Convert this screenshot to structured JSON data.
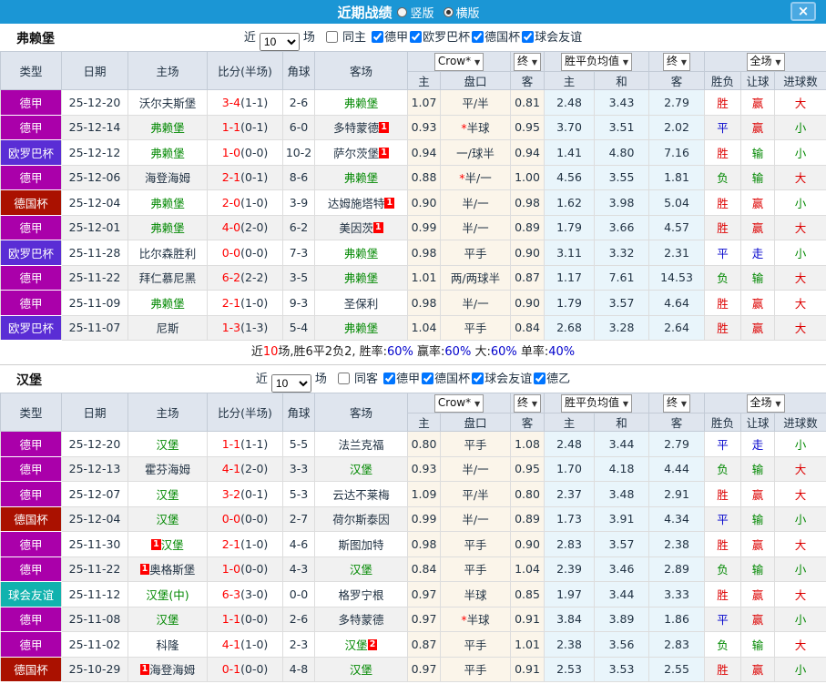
{
  "title_bar": {
    "title": "近期战绩",
    "layout_options": [
      {
        "label": "竖版",
        "selected": false
      },
      {
        "label": "横版",
        "selected": true
      }
    ],
    "close_label": "×"
  },
  "table_header": {
    "left_cols": [
      "类型",
      "日期",
      "主场",
      "比分(半场)",
      "角球",
      "客场"
    ],
    "odds_dropdown": "Crow*",
    "odds_final_dropdown": "终",
    "odds_cols": [
      "主",
      "盘口",
      "客"
    ],
    "avg_dropdown": "胜平负均值",
    "avg_final_dropdown": "终",
    "scope_dropdown": "全场",
    "result_cols": [
      "胜负",
      "让球",
      "进球数"
    ]
  },
  "colors": {
    "accent_bar": "#1b96d5",
    "focal_team": "#008800",
    "score": "#ff0000",
    "league": {
      "德甲": "#aa00aa",
      "欧罗巴杯": "#5a2dd5",
      "德国杯": "#aa1100",
      "球会友谊": "#11b2ae"
    },
    "outcome": {
      "胜": "#dd0000",
      "平": "#0000cc",
      "负": "#008800",
      "赢": "#dd0000",
      "走": "#0000cc",
      "输": "#008800",
      "大": "#dd0000",
      "小": "#008800"
    }
  },
  "sections": [
    {
      "team": "弗赖堡",
      "filter": {
        "prefix": "近",
        "count": "10",
        "suffix": "场",
        "same": {
          "label": "同主",
          "checked": false
        },
        "leagues": [
          {
            "label": "德甲",
            "checked": true
          },
          {
            "label": "欧罗巴杯",
            "checked": true
          },
          {
            "label": "德国杯",
            "checked": true
          },
          {
            "label": "球会友谊",
            "checked": true
          }
        ]
      },
      "rows": [
        {
          "league": "德甲",
          "date": "25-12-20",
          "home": {
            "name": "沃尔夫斯堡",
            "focal": false
          },
          "score": "3-4",
          "half": "(1-1)",
          "corners": "2-6",
          "away": {
            "name": "弗赖堡",
            "focal": true
          },
          "odds": [
            "1.07",
            "平/半",
            "0.81"
          ],
          "odds_star": false,
          "avg": [
            "2.48",
            "3.43",
            "2.79"
          ],
          "outcome": [
            "胜",
            "赢",
            "大"
          ]
        },
        {
          "league": "德甲",
          "date": "25-12-14",
          "home": {
            "name": "弗赖堡",
            "focal": true
          },
          "score": "1-1",
          "half": "(0-1)",
          "corners": "6-0",
          "away": {
            "name": "多特蒙德",
            "focal": false,
            "badge": "1",
            "badge_side": "right"
          },
          "odds": [
            "0.93",
            "半球",
            "0.95"
          ],
          "odds_star": true,
          "avg": [
            "3.70",
            "3.51",
            "2.02"
          ],
          "outcome": [
            "平",
            "赢",
            "小"
          ]
        },
        {
          "league": "欧罗巴杯",
          "date": "25-12-12",
          "home": {
            "name": "弗赖堡",
            "focal": true
          },
          "score": "1-0",
          "half": "(0-0)",
          "corners": "10-2",
          "away": {
            "name": "萨尔茨堡",
            "focal": false,
            "badge": "1",
            "badge_side": "right"
          },
          "odds": [
            "0.94",
            "一/球半",
            "0.94"
          ],
          "odds_star": false,
          "avg": [
            "1.41",
            "4.80",
            "7.16"
          ],
          "outcome": [
            "胜",
            "输",
            "小"
          ]
        },
        {
          "league": "德甲",
          "date": "25-12-06",
          "home": {
            "name": "海登海姆",
            "focal": false
          },
          "score": "2-1",
          "half": "(0-1)",
          "corners": "8-6",
          "away": {
            "name": "弗赖堡",
            "focal": true
          },
          "odds": [
            "0.88",
            "半/一",
            "1.00"
          ],
          "odds_star": true,
          "avg": [
            "4.56",
            "3.55",
            "1.81"
          ],
          "outcome": [
            "负",
            "输",
            "大"
          ]
        },
        {
          "league": "德国杯",
          "date": "25-12-04",
          "home": {
            "name": "弗赖堡",
            "focal": true
          },
          "score": "2-0",
          "half": "(1-0)",
          "corners": "3-9",
          "away": {
            "name": "达姆施塔特",
            "focal": false,
            "badge": "1",
            "badge_side": "right"
          },
          "odds": [
            "0.90",
            "半/一",
            "0.98"
          ],
          "odds_star": false,
          "avg": [
            "1.62",
            "3.98",
            "5.04"
          ],
          "outcome": [
            "胜",
            "赢",
            "小"
          ]
        },
        {
          "league": "德甲",
          "date": "25-12-01",
          "home": {
            "name": "弗赖堡",
            "focal": true
          },
          "score": "4-0",
          "half": "(2-0)",
          "corners": "6-2",
          "away": {
            "name": "美因茨",
            "focal": false,
            "badge": "1",
            "badge_side": "right"
          },
          "odds": [
            "0.99",
            "半/一",
            "0.89"
          ],
          "odds_star": false,
          "avg": [
            "1.79",
            "3.66",
            "4.57"
          ],
          "outcome": [
            "胜",
            "赢",
            "大"
          ]
        },
        {
          "league": "欧罗巴杯",
          "date": "25-11-28",
          "home": {
            "name": "比尔森胜利",
            "focal": false
          },
          "score": "0-0",
          "half": "(0-0)",
          "corners": "7-3",
          "away": {
            "name": "弗赖堡",
            "focal": true
          },
          "odds": [
            "0.98",
            "平手",
            "0.90"
          ],
          "odds_star": false,
          "avg": [
            "3.11",
            "3.32",
            "2.31"
          ],
          "outcome": [
            "平",
            "走",
            "小"
          ]
        },
        {
          "league": "德甲",
          "date": "25-11-22",
          "home": {
            "name": "拜仁慕尼黑",
            "focal": false
          },
          "score": "6-2",
          "half": "(2-2)",
          "corners": "3-5",
          "away": {
            "name": "弗赖堡",
            "focal": true
          },
          "odds": [
            "1.01",
            "两/两球半",
            "0.87"
          ],
          "odds_star": false,
          "avg": [
            "1.17",
            "7.61",
            "14.53"
          ],
          "outcome": [
            "负",
            "输",
            "大"
          ]
        },
        {
          "league": "德甲",
          "date": "25-11-09",
          "home": {
            "name": "弗赖堡",
            "focal": true
          },
          "score": "2-1",
          "half": "(1-0)",
          "corners": "9-3",
          "away": {
            "name": "圣保利",
            "focal": false
          },
          "odds": [
            "0.98",
            "半/一",
            "0.90"
          ],
          "odds_star": false,
          "avg": [
            "1.79",
            "3.57",
            "4.64"
          ],
          "outcome": [
            "胜",
            "赢",
            "大"
          ]
        },
        {
          "league": "欧罗巴杯",
          "date": "25-11-07",
          "home": {
            "name": "尼斯",
            "focal": false
          },
          "score": "1-3",
          "half": "(1-3)",
          "corners": "5-4",
          "away": {
            "name": "弗赖堡",
            "focal": true
          },
          "odds": [
            "1.04",
            "平手",
            "0.84"
          ],
          "odds_star": false,
          "avg": [
            "2.68",
            "3.28",
            "2.64"
          ],
          "outcome": [
            "胜",
            "赢",
            "大"
          ]
        }
      ],
      "summary": [
        {
          "t": "近"
        },
        {
          "t": "10",
          "c": "red"
        },
        {
          "t": "场,胜6平2负2, 胜率:"
        },
        {
          "t": "60%",
          "c": "blue"
        },
        {
          "t": " 赢率:"
        },
        {
          "t": "60%",
          "c": "blue"
        },
        {
          "t": " 大:"
        },
        {
          "t": "60%",
          "c": "blue"
        },
        {
          "t": " 单率:"
        },
        {
          "t": "40%",
          "c": "blue"
        }
      ]
    },
    {
      "team": "汉堡",
      "filter": {
        "prefix": "近",
        "count": "10",
        "suffix": "场",
        "same": {
          "label": "同客",
          "checked": false
        },
        "leagues": [
          {
            "label": "德甲",
            "checked": true
          },
          {
            "label": "德国杯",
            "checked": true
          },
          {
            "label": "球会友谊",
            "checked": true
          },
          {
            "label": "德乙",
            "checked": true
          }
        ]
      },
      "rows": [
        {
          "league": "德甲",
          "date": "25-12-20",
          "home": {
            "name": "汉堡",
            "focal": true
          },
          "score": "1-1",
          "half": "(1-1)",
          "corners": "5-5",
          "away": {
            "name": "法兰克福",
            "focal": false
          },
          "odds": [
            "0.80",
            "平手",
            "1.08"
          ],
          "odds_star": false,
          "avg": [
            "2.48",
            "3.44",
            "2.79"
          ],
          "outcome": [
            "平",
            "走",
            "小"
          ]
        },
        {
          "league": "德甲",
          "date": "25-12-13",
          "home": {
            "name": "霍芬海姆",
            "focal": false
          },
          "score": "4-1",
          "half": "(2-0)",
          "corners": "3-3",
          "away": {
            "name": "汉堡",
            "focal": true
          },
          "odds": [
            "0.93",
            "半/一",
            "0.95"
          ],
          "odds_star": false,
          "avg": [
            "1.70",
            "4.18",
            "4.44"
          ],
          "outcome": [
            "负",
            "输",
            "大"
          ]
        },
        {
          "league": "德甲",
          "date": "25-12-07",
          "home": {
            "name": "汉堡",
            "focal": true
          },
          "score": "3-2",
          "half": "(0-1)",
          "corners": "5-3",
          "away": {
            "name": "云达不莱梅",
            "focal": false
          },
          "odds": [
            "1.09",
            "平/半",
            "0.80"
          ],
          "odds_star": false,
          "avg": [
            "2.37",
            "3.48",
            "2.91"
          ],
          "outcome": [
            "胜",
            "赢",
            "大"
          ]
        },
        {
          "league": "德国杯",
          "date": "25-12-04",
          "home": {
            "name": "汉堡",
            "focal": true
          },
          "score": "0-0",
          "half": "(0-0)",
          "corners": "2-7",
          "away": {
            "name": "荷尔斯泰因",
            "focal": false
          },
          "odds": [
            "0.99",
            "半/一",
            "0.89"
          ],
          "odds_star": false,
          "avg": [
            "1.73",
            "3.91",
            "4.34"
          ],
          "outcome": [
            "平",
            "输",
            "小"
          ]
        },
        {
          "league": "德甲",
          "date": "25-11-30",
          "home": {
            "name": "汉堡",
            "focal": true,
            "badge": "1",
            "badge_side": "left"
          },
          "score": "2-1",
          "half": "(1-0)",
          "corners": "4-6",
          "away": {
            "name": "斯图加特",
            "focal": false
          },
          "odds": [
            "0.98",
            "平手",
            "0.90"
          ],
          "odds_star": false,
          "avg": [
            "2.83",
            "3.57",
            "2.38"
          ],
          "outcome": [
            "胜",
            "赢",
            "大"
          ]
        },
        {
          "league": "德甲",
          "date": "25-11-22",
          "home": {
            "name": "奥格斯堡",
            "focal": false,
            "badge": "1",
            "badge_side": "left"
          },
          "score": "1-0",
          "half": "(0-0)",
          "corners": "4-3",
          "away": {
            "name": "汉堡",
            "focal": true
          },
          "odds": [
            "0.84",
            "平手",
            "1.04"
          ],
          "odds_star": false,
          "avg": [
            "2.39",
            "3.46",
            "2.89"
          ],
          "outcome": [
            "负",
            "输",
            "小"
          ]
        },
        {
          "league": "球会友谊",
          "date": "25-11-12",
          "home": {
            "name": "汉堡(中)",
            "focal": true
          },
          "score": "6-3",
          "half": "(3-0)",
          "corners": "0-0",
          "away": {
            "name": "格罗宁根",
            "focal": false
          },
          "odds": [
            "0.97",
            "半球",
            "0.85"
          ],
          "odds_star": false,
          "avg": [
            "1.97",
            "3.44",
            "3.33"
          ],
          "outcome": [
            "胜",
            "赢",
            "大"
          ]
        },
        {
          "league": "德甲",
          "date": "25-11-08",
          "home": {
            "name": "汉堡",
            "focal": true
          },
          "score": "1-1",
          "half": "(0-0)",
          "corners": "2-6",
          "away": {
            "name": "多特蒙德",
            "focal": false
          },
          "odds": [
            "0.97",
            "半球",
            "0.91"
          ],
          "odds_star": true,
          "avg": [
            "3.84",
            "3.89",
            "1.86"
          ],
          "outcome": [
            "平",
            "赢",
            "小"
          ]
        },
        {
          "league": "德甲",
          "date": "25-11-02",
          "home": {
            "name": "科隆",
            "focal": false
          },
          "score": "4-1",
          "half": "(1-0)",
          "corners": "2-3",
          "away": {
            "name": "汉堡",
            "focal": true,
            "badge": "2",
            "badge_side": "right"
          },
          "odds": [
            "0.87",
            "平手",
            "1.01"
          ],
          "odds_star": false,
          "avg": [
            "2.38",
            "3.56",
            "2.83"
          ],
          "outcome": [
            "负",
            "输",
            "大"
          ]
        },
        {
          "league": "德国杯",
          "date": "25-10-29",
          "home": {
            "name": "海登海姆",
            "focal": false,
            "badge": "1",
            "badge_side": "left"
          },
          "score": "0-1",
          "half": "(0-0)",
          "corners": "4-8",
          "away": {
            "name": "汉堡",
            "focal": true
          },
          "odds": [
            "0.97",
            "平手",
            "0.91"
          ],
          "odds_star": false,
          "avg": [
            "2.53",
            "3.53",
            "2.55"
          ],
          "outcome": [
            "胜",
            "赢",
            "小"
          ]
        }
      ],
      "summary": null
    }
  ]
}
